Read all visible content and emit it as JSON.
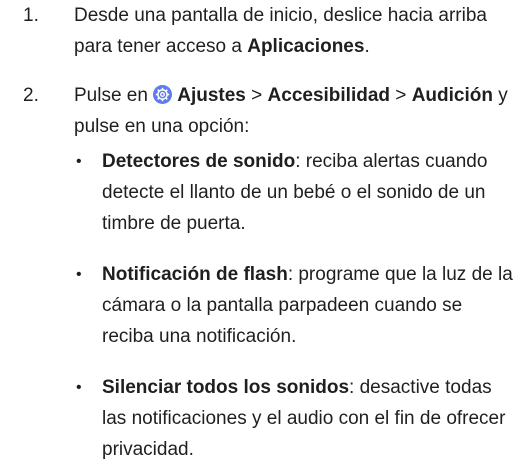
{
  "steps": [
    {
      "number": "1.",
      "text_before": "Desde una pantalla de inicio, deslice hacia arriba para tener acceso a ",
      "bold": "Aplicaciones",
      "text_after": "."
    },
    {
      "number": "2.",
      "prefix": "Pulse en ",
      "icon": "settings-gear-icon",
      "path": [
        "Ajustes",
        "Accesibilidad",
        "Audición"
      ],
      "separator": " > ",
      "suffix": " y pulse en una opción:"
    }
  ],
  "bullets": [
    {
      "title": "Detectores de sonido",
      "text": ": reciba alertas cuando detecte el llanto de un bebé o el sonido de un timbre de puerta."
    },
    {
      "title": "Notificación de flash",
      "text": ": programe que la luz de la cámara o la pantalla parpadeen cuando se reciba una notificación."
    },
    {
      "title": "Silenciar todos los sonidos",
      "text": ": desactive todas las notificaciones y el audio con el fin de ofrecer privacidad."
    }
  ],
  "bullet_symbol": "•",
  "colors": {
    "text": "#1f1f1f",
    "icon_bg": "#5c7cf0"
  }
}
